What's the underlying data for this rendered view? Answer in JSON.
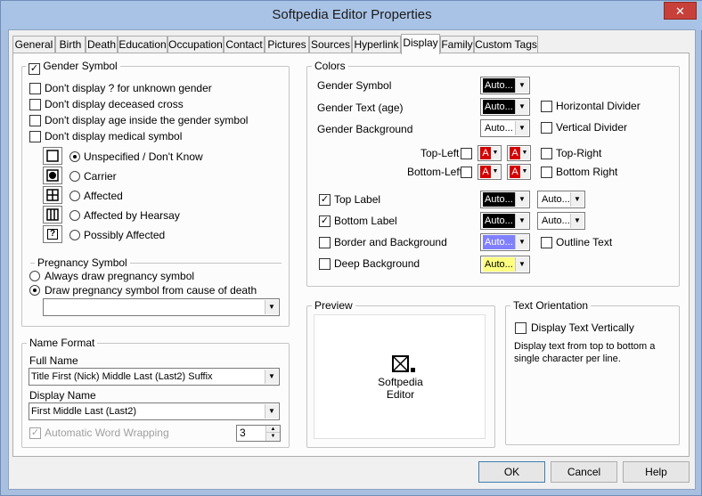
{
  "window": {
    "title": "Softpedia Editor Properties",
    "close_glyph": "✕"
  },
  "tabs": [
    "General",
    "Birth",
    "Death",
    "Education",
    "Occupation",
    "Contact",
    "Pictures",
    "Sources",
    "Hyperlink",
    "Display",
    "Family",
    "Custom Tags"
  ],
  "active_tab": "Display",
  "gender_group": {
    "title": "Gender Symbol",
    "title_checked": true,
    "options": [
      {
        "label": "Don't display ? for unknown gender",
        "checked": false
      },
      {
        "label": "Don't display deceased cross",
        "checked": false
      },
      {
        "label": "Don't display age inside the gender symbol",
        "checked": false
      },
      {
        "label": "Don't display medical symbol",
        "checked": false
      }
    ],
    "medical": [
      {
        "label": "Unspecified / Don't Know",
        "selected": true,
        "icon": "empty-square-icon"
      },
      {
        "label": "Carrier",
        "selected": false,
        "icon": "carrier-icon"
      },
      {
        "label": "Affected",
        "selected": false,
        "icon": "affected-icon"
      },
      {
        "label": "Affected by Hearsay",
        "selected": false,
        "icon": "hearsay-icon"
      },
      {
        "label": "Possibly Affected",
        "selected": false,
        "icon": "possibly-affected-icon",
        "glyph": "?"
      }
    ],
    "pregnancy_title": "Pregnancy Symbol",
    "pregnancy": [
      {
        "label": "Always draw pregnancy symbol",
        "selected": false
      },
      {
        "label": "Draw pregnancy symbol from cause of death",
        "selected": true
      }
    ],
    "pregnancy_value": ""
  },
  "name_format": {
    "title": "Name Format",
    "full_name_label": "Full Name",
    "full_name_value": "Title First (Nick) Middle Last (Last2) Suffix",
    "display_name_label": "Display Name",
    "display_name_value": "First Middle Last (Last2)",
    "wrap_label": "Automatic Word Wrapping",
    "wrap_checked": true,
    "wrap_value": "3"
  },
  "colors": {
    "title": "Colors",
    "gender_symbol": {
      "label": "Gender Symbol",
      "value": "Auto..."
    },
    "gender_text": {
      "label": "Gender Text (age)",
      "value": "Auto..."
    },
    "gender_background": {
      "label": "Gender Background",
      "value": "Auto..."
    },
    "horizontal_divider": "Horizontal Divider",
    "vertical_divider": "Vertical Divider",
    "top_left": "Top-Left",
    "top_right": "Top-Right",
    "bottom_left": "Bottom-Left",
    "bottom_right": "Bottom Right",
    "a_glyph": "A",
    "top_label": {
      "label": "Top Label",
      "checked": true,
      "value": "Auto...",
      "value2": "Auto..."
    },
    "bottom_label": {
      "label": "Bottom Label",
      "checked": true,
      "value": "Auto...",
      "value2": "Auto..."
    },
    "border_bg": {
      "label": "Border and Background",
      "checked": false,
      "value": "Auto..."
    },
    "outline_text": "Outline Text",
    "deep_bg": {
      "label": "Deep Background",
      "checked": false,
      "value": "Auto..."
    },
    "dark": "#000000",
    "border_swatch": "#8080ff",
    "deep_swatch": "#ffff80",
    "red": "#d40000"
  },
  "preview": {
    "title": "Preview",
    "line1": "Softpedia",
    "line2": "Editor"
  },
  "orientation": {
    "title": "Text Orientation",
    "checkbox_label": "Display Text Vertically",
    "checked": false,
    "description": "Display text from top to bottom a single character per line."
  },
  "buttons": {
    "ok": "OK",
    "cancel": "Cancel",
    "help": "Help"
  },
  "arrow_glyph": "▼"
}
